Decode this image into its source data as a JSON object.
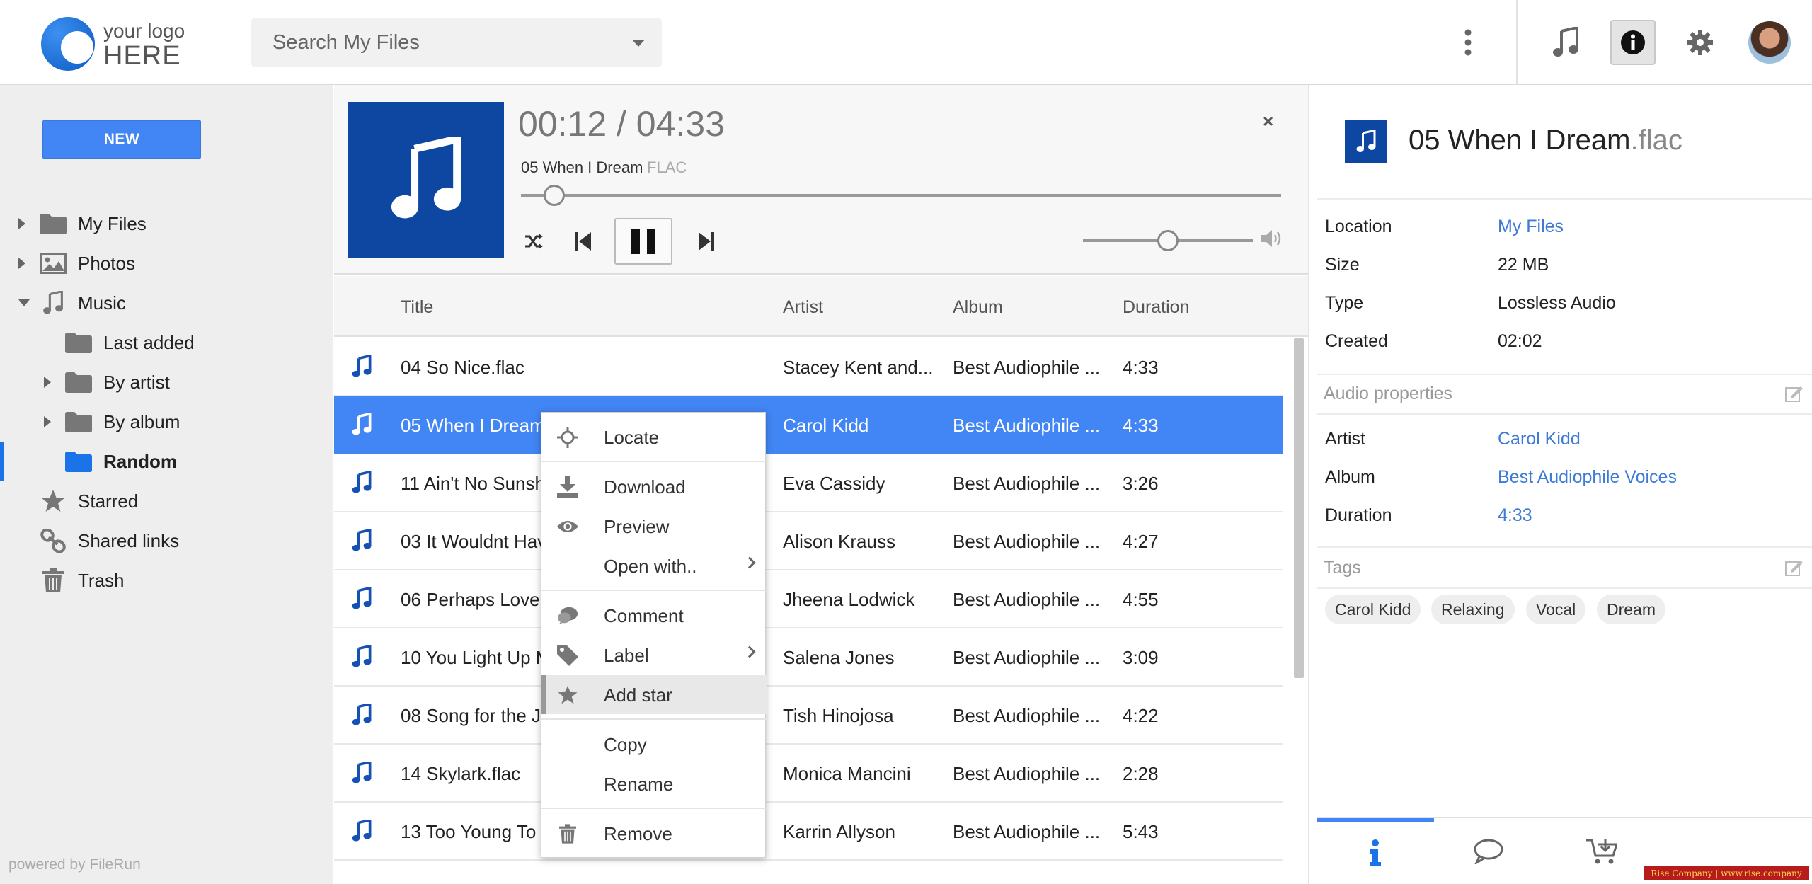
{
  "logo": {
    "line1": "your logo",
    "line2": "HERE"
  },
  "search": {
    "placeholder": "Search My Files"
  },
  "sidebar": {
    "new_label": "NEW",
    "items": [
      {
        "label": "My Files"
      },
      {
        "label": "Photos"
      },
      {
        "label": "Music"
      },
      {
        "label": "Last added"
      },
      {
        "label": "By artist"
      },
      {
        "label": "By album"
      },
      {
        "label": "Random"
      },
      {
        "label": "Starred"
      },
      {
        "label": "Shared links"
      },
      {
        "label": "Trash"
      }
    ],
    "powered": "powered by FileRun"
  },
  "player": {
    "time": "00:12 / 04:33",
    "track_name": "05 When I Dream",
    "track_type": "FLAC",
    "close": "×",
    "progress": 0.044,
    "volume": 0.5
  },
  "list": {
    "headers": {
      "title": "Title",
      "artist": "Artist",
      "album": "Album",
      "duration": "Duration"
    },
    "rows": [
      {
        "title": "04 So Nice.flac",
        "artist": "Stacey Kent and...",
        "album": "Best Audiophile ...",
        "duration": "4:33"
      },
      {
        "title": "05 When I Dream",
        "artist": "Carol Kidd",
        "album": "Best Audiophile ...",
        "duration": "4:33"
      },
      {
        "title": "11 Ain't No Sunsh",
        "artist": "Eva Cassidy",
        "album": "Best Audiophile ...",
        "duration": "3:26"
      },
      {
        "title": "03 It Wouldnt Hav",
        "artist": "Alison Krauss",
        "album": "Best Audiophile ...",
        "duration": "4:27"
      },
      {
        "title": "06 Perhaps Love.",
        "artist": "Jheena Lodwick",
        "album": "Best Audiophile ...",
        "duration": "4:55"
      },
      {
        "title": "10 You Light Up M",
        "artist": "Salena Jones",
        "album": "Best Audiophile ...",
        "duration": "3:09"
      },
      {
        "title": "08 Song for the J",
        "artist": "Tish Hinojosa",
        "album": "Best Audiophile ...",
        "duration": "4:22"
      },
      {
        "title": "14 Skylark.flac",
        "artist": "Monica Mancini",
        "album": "Best Audiophile ...",
        "duration": "2:28"
      },
      {
        "title": "13 Too Young To",
        "artist": "Karrin Allyson",
        "album": "Best Audiophile ...",
        "duration": "5:43"
      }
    ]
  },
  "context_menu": {
    "locate": "Locate",
    "download": "Download",
    "preview": "Preview",
    "open_with": "Open with..",
    "comment": "Comment",
    "label": "Label",
    "add_star": "Add star",
    "copy": "Copy",
    "rename": "Rename",
    "remove": "Remove"
  },
  "details": {
    "title": "05 When I Dream",
    "ext": ".flac",
    "props": {
      "location_k": "Location",
      "location_v": "My Files",
      "size_k": "Size",
      "size_v": "22 MB",
      "type_k": "Type",
      "type_v": "Lossless Audio",
      "created_k": "Created",
      "created_v": "02:02"
    },
    "audio_title": "Audio properties",
    "audio": {
      "artist_k": "Artist",
      "artist_v": "Carol Kidd",
      "album_k": "Album",
      "album_v": "Best Audiophile Voices",
      "duration_k": "Duration",
      "duration_v": "4:33"
    },
    "tags_title": "Tags",
    "tags": [
      "Carol Kidd",
      "Relaxing",
      "Vocal",
      "Dream"
    ]
  },
  "watermark": "Rise Company | www.rise.company",
  "colors": {
    "accent": "#4285f4",
    "cover": "#0d47a1",
    "link": "#3d7bd6"
  }
}
